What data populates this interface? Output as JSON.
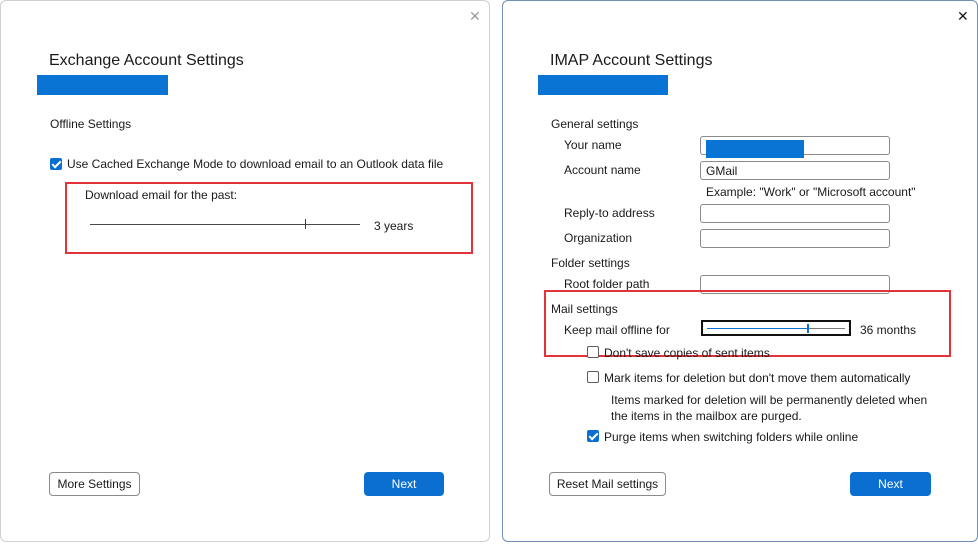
{
  "left": {
    "title": "Exchange Account Settings",
    "offline_heading": "Offline Settings",
    "cached_mode_label": "Use Cached Exchange Mode to download email to an Outlook data file",
    "cached_mode_checked": true,
    "download_label": "Download email for the past:",
    "download_value": "3 years",
    "more_settings": "More Settings",
    "next": "Next",
    "close_icon": "close-icon"
  },
  "right": {
    "title": "IMAP Account Settings",
    "general_heading": "General settings",
    "your_name_label": "Your name",
    "account_name_label": "Account name",
    "account_name_value": "GMail",
    "example_text": "Example: \"Work\" or \"Microsoft account\"",
    "reply_to_label": "Reply-to address",
    "organization_label": "Organization",
    "folder_heading": "Folder settings",
    "root_folder_label": "Root folder path",
    "mail_heading": "Mail settings",
    "keep_offline_label": "Keep mail offline for",
    "keep_offline_value": "36 months",
    "dont_save_label": "Don't save copies of sent items",
    "dont_save_checked": false,
    "mark_deletion_label": "Mark items for deletion but don't move them automatically",
    "mark_deletion_checked": false,
    "deletion_note_line1": "Items marked for deletion will be permanently deleted when",
    "deletion_note_line2": "the items in the mailbox are purged.",
    "purge_label": "Purge items when switching folders while online",
    "purge_checked": true,
    "reset_mail": "Reset Mail settings",
    "next": "Next",
    "close_icon": "close-icon"
  },
  "colors": {
    "accent": "#0a6fd1",
    "redact": "#0a74d4",
    "highlight_red": "#e2333b"
  }
}
